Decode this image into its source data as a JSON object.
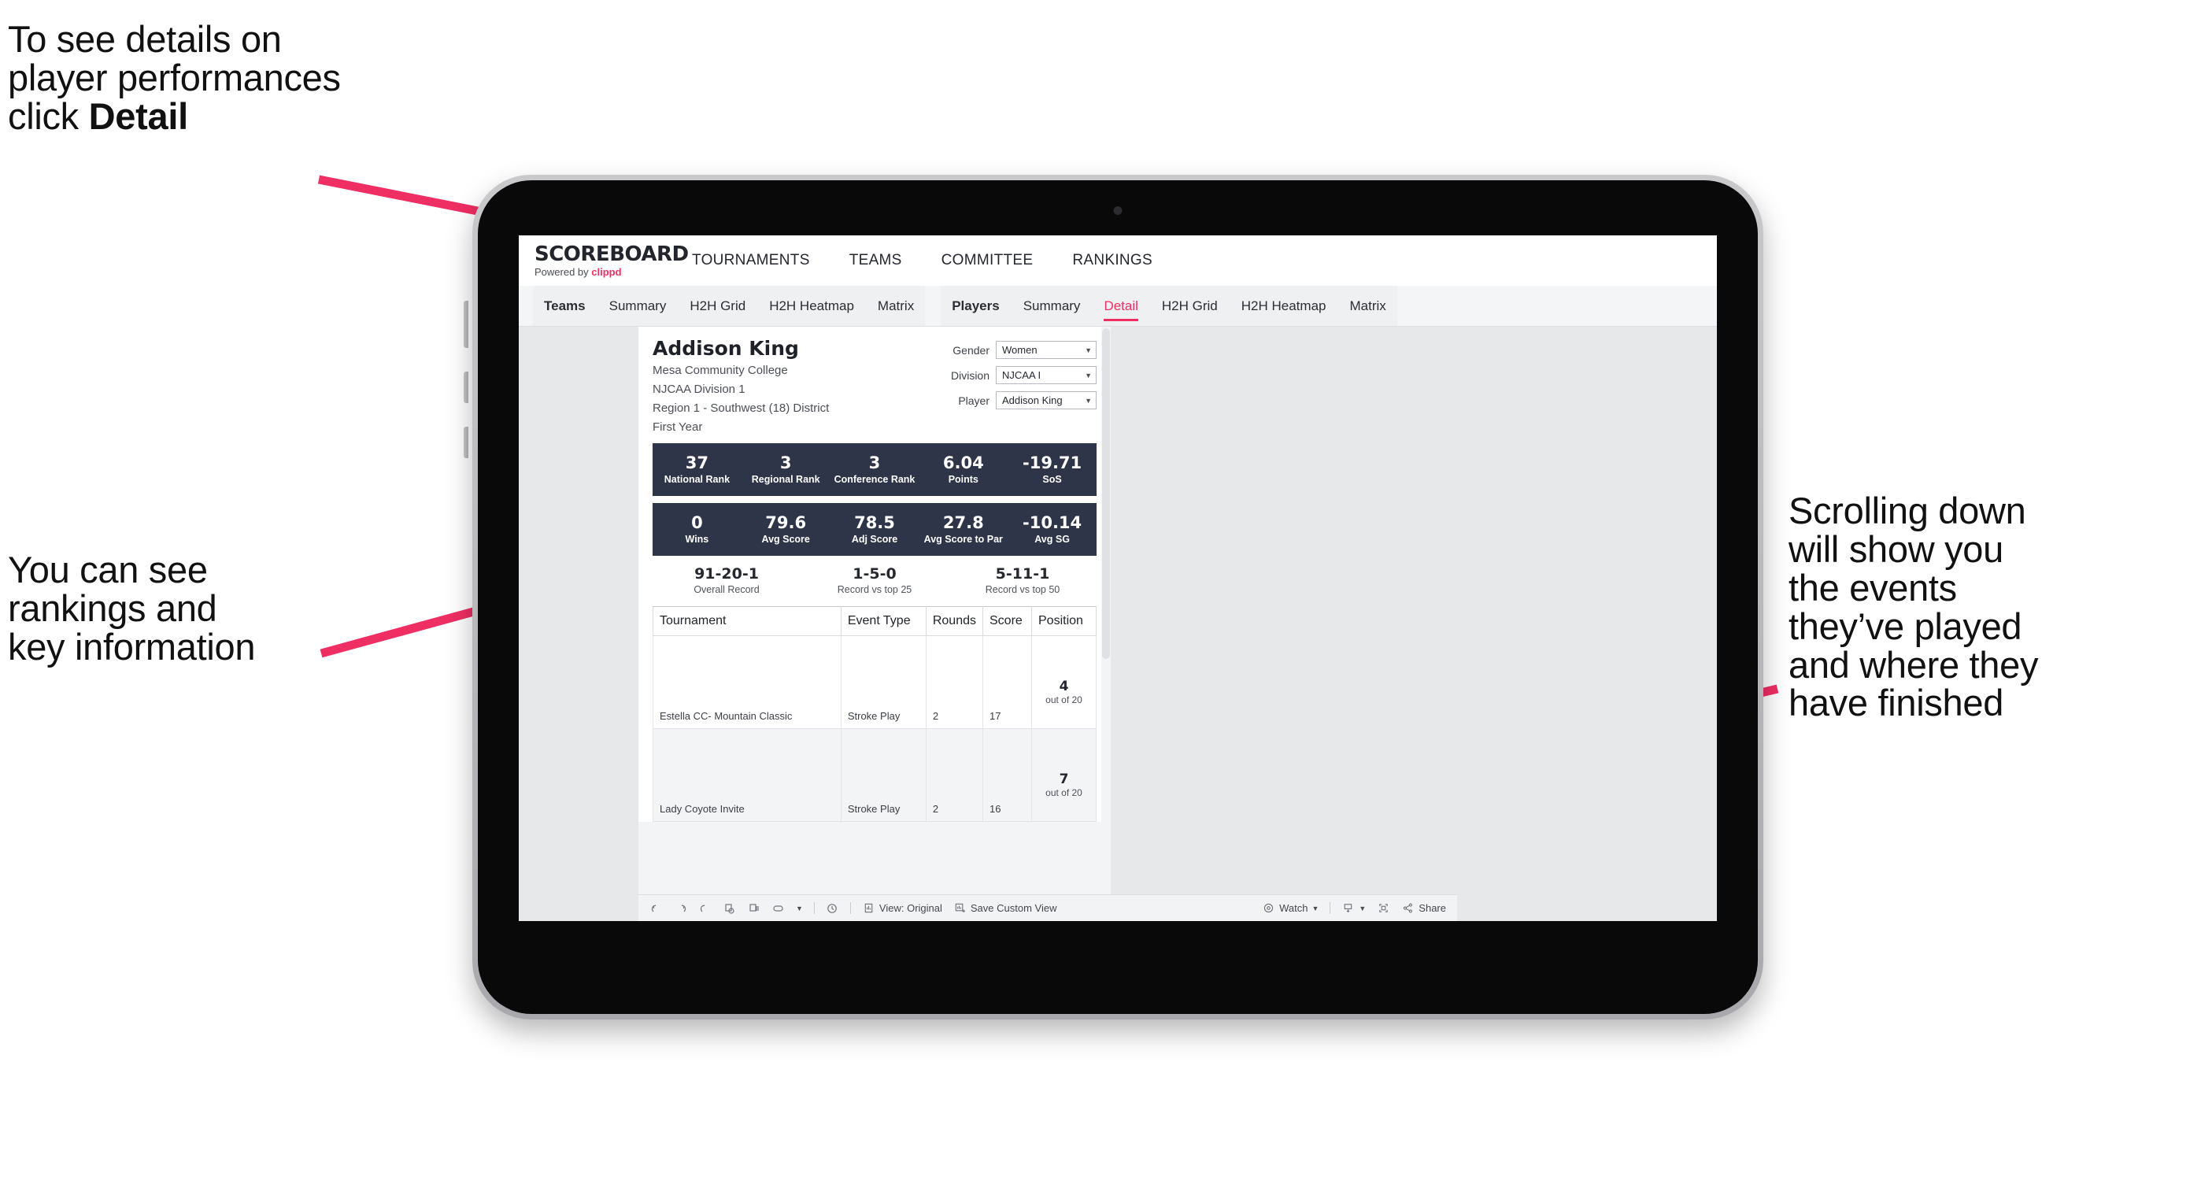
{
  "annotations": {
    "detail": {
      "pre": "To see details on\nplayer performances\nclick ",
      "bold": "Detail"
    },
    "rankings": "You can see\nrankings and\nkey information",
    "scrolling": "Scrolling down\nwill show you\nthe events\nthey’ve played\nand where they\nhave finished"
  },
  "colors": {
    "accent": "#ef2e63",
    "band": "#2e3548",
    "screen_bg": "#e6e8ea"
  },
  "browser": {
    "brand": {
      "name": "SCOREBOARD",
      "powered_prefix": "Powered by ",
      "powered_brand": "clippd"
    },
    "nav_links": [
      "TOURNAMENTS",
      "TEAMS",
      "COMMITTEE",
      "RANKINGS"
    ],
    "tabs_teams": [
      "Teams",
      "Summary",
      "H2H Grid",
      "H2H Heatmap",
      "Matrix"
    ],
    "tabs_players": [
      "Players",
      "Summary",
      "Detail",
      "H2H Grid",
      "H2H Heatmap",
      "Matrix"
    ],
    "active_tab": "Detail"
  },
  "player": {
    "name": "Addison King",
    "school": "Mesa Community College",
    "division": "NJCAA Division 1",
    "region": "Region 1 - Southwest (18) District",
    "year": "First Year"
  },
  "filters": [
    {
      "label": "Gender",
      "value": "Women"
    },
    {
      "label": "Division",
      "value": "NJCAA I"
    },
    {
      "label": "Player",
      "value": "Addison King"
    }
  ],
  "stats_row1": [
    {
      "value": "37",
      "label": "National Rank"
    },
    {
      "value": "3",
      "label": "Regional Rank"
    },
    {
      "value": "3",
      "label": "Conference Rank"
    },
    {
      "value": "6.04",
      "label": "Points"
    },
    {
      "value": "-19.71",
      "label": "SoS"
    }
  ],
  "stats_row2": [
    {
      "value": "0",
      "label": "Wins"
    },
    {
      "value": "79.6",
      "label": "Avg Score"
    },
    {
      "value": "78.5",
      "label": "Adj Score"
    },
    {
      "value": "27.8",
      "label": "Avg Score to Par"
    },
    {
      "value": "-10.14",
      "label": "Avg SG"
    }
  ],
  "records": [
    {
      "value": "91-20-1",
      "label": "Overall Record"
    },
    {
      "value": "1-5-0",
      "label": "Record vs top 25"
    },
    {
      "value": "5-11-1",
      "label": "Record vs top 50"
    }
  ],
  "table": {
    "headers": [
      "Tournament",
      "Event Type",
      "Rounds",
      "Score",
      "Position"
    ],
    "rows": [
      {
        "tournament": "Estella CC- Mountain Classic",
        "event_type": "Stroke Play",
        "rounds": "2",
        "score": "17",
        "position": "4",
        "position_of": "out of 20"
      },
      {
        "tournament": "Lady Coyote Invite",
        "event_type": "Stroke Play",
        "rounds": "2",
        "score": "16",
        "position": "7",
        "position_of": "out of 20"
      }
    ]
  },
  "toolbar": {
    "view_label": "View: Original",
    "save_label": "Save Custom View",
    "watch_label": "Watch",
    "share_label": "Share"
  }
}
